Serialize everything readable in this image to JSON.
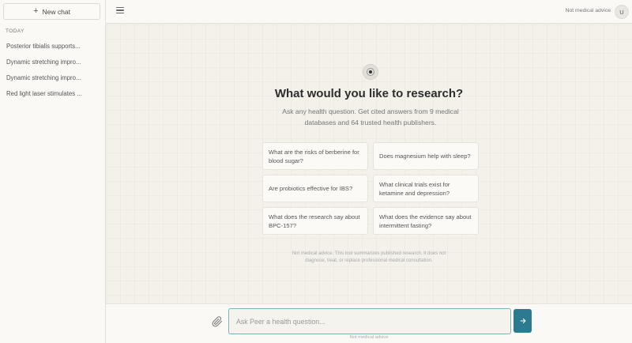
{
  "sidebar": {
    "new_chat_label": "New chat",
    "section_label": "TODAY",
    "items": [
      {
        "label": "Posterior tibialis supports..."
      },
      {
        "label": "Dynamic stretching impro..."
      },
      {
        "label": "Dynamic stretching impro..."
      },
      {
        "label": "Red light laser stimulates ..."
      }
    ]
  },
  "header": {
    "disclaimer": "Not medical advice",
    "avatar_initial": "U"
  },
  "main": {
    "title": "What would you like to research?",
    "subtitle": "Ask any health question. Get cited answers from 9 medical databases and 64 trusted health publishers.",
    "suggestions": [
      {
        "label": "What are the risks of berberine for blood sugar?"
      },
      {
        "label": "Does magnesium help with sleep?"
      },
      {
        "label": "Are probiotics effective for IBS?"
      },
      {
        "label": "What clinical trials exist for ketamine and depression?"
      },
      {
        "label": "What does the research say about BPC-157?"
      },
      {
        "label": "What does the evidence say about intermittent fasting?"
      }
    ],
    "footer_note": "Not medical advice. This tool summarizes published research. It does not diagnose, treat, or replace professional medical consultation."
  },
  "composer": {
    "placeholder": "Ask Peer a health question...",
    "disclaimer": "Not medical advice"
  },
  "colors": {
    "accent": "#2c7a8f",
    "input_border": "#7fb0bc",
    "background": "#f3f1ea"
  },
  "icons": {
    "menu": "hamburger-menu-icon",
    "attach": "paperclip-icon",
    "send": "arrow-right-icon",
    "plus": "plus-icon"
  }
}
